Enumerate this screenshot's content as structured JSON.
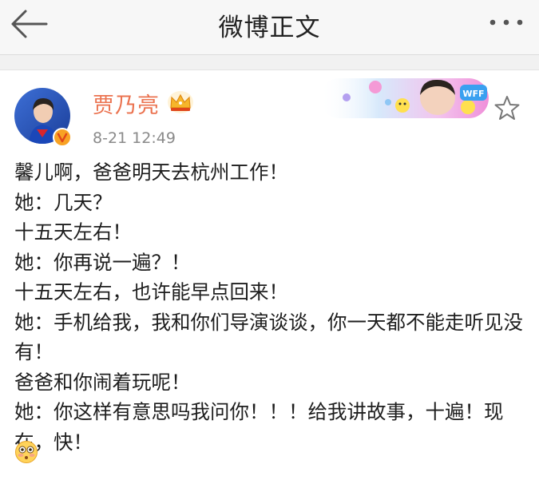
{
  "header": {
    "title": "微博正文",
    "back_icon": "arrow-left-icon",
    "more_icon": "more-dots-icon"
  },
  "post": {
    "author": "贾乃亮",
    "timestamp": "8-21 12:49",
    "badge_icon": "verified-v-icon",
    "member_icon": "crown-icon",
    "banner_text": "WFF",
    "lines": [
      "馨儿啊，爸爸明天去杭州工作！",
      "她：几天？",
      "十五天左右！",
      "她：你再说一遍？！",
      "十五天左右，也许能早点回来！",
      "她：手机给我，我和你们导演谈谈，你一天都不能走听见没有！",
      "爸爸和你闹着玩呢！",
      "她：你这样有意思吗我问你！！！给我讲故事，十遍！现在，快！"
    ],
    "emoji_icon": "flushed-face-icon"
  },
  "colors": {
    "author": "#eb7350",
    "timestamp": "#8a8a8a",
    "topbar_bg": "#f7f7f7"
  }
}
